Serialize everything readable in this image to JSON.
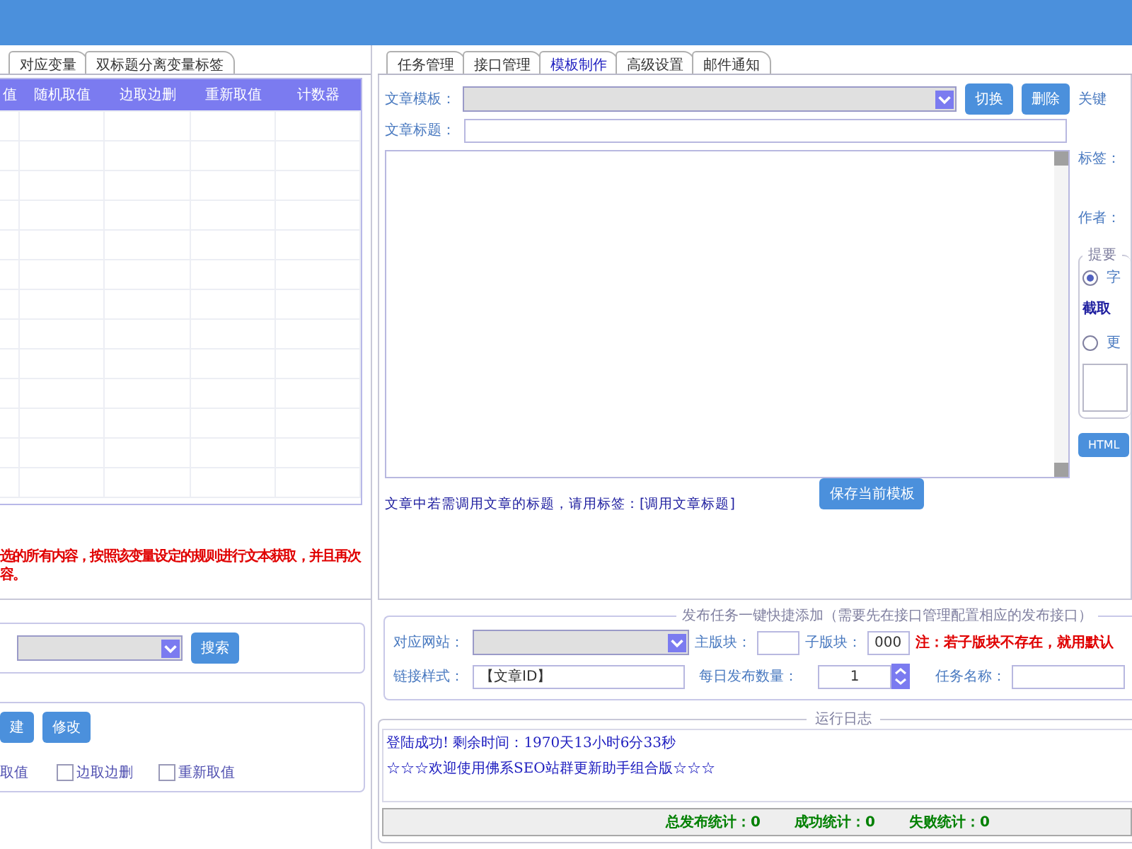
{
  "left_panel": {
    "tabs": [
      {
        "label": "对应变量",
        "selected": false
      },
      {
        "label": "双标题分离变量标签",
        "selected": false
      }
    ],
    "table": {
      "columns": [
        "值",
        "随机取值",
        "边取边删",
        "重新取值",
        "计数器"
      ]
    },
    "note_lines": [
      "选的所有内容，按照该变量设定的规则进行文本获取，并且再次",
      "容。"
    ],
    "search": {
      "button": "搜索"
    },
    "edit_group": {
      "buttons": [
        "建",
        "修改"
      ],
      "cut_label": "取值",
      "checkboxes": [
        {
          "label": "边取边删",
          "checked": false
        },
        {
          "label": "重新取值",
          "checked": false
        }
      ]
    }
  },
  "right_panel": {
    "tabs": [
      {
        "label": "任务管理",
        "selected": false
      },
      {
        "label": "接口管理",
        "selected": false
      },
      {
        "label": "模板制作",
        "selected": true
      },
      {
        "label": "高级设置",
        "selected": false
      },
      {
        "label": "邮件通知",
        "selected": false
      }
    ],
    "template_label": "文章模板：",
    "template_buttons": [
      "切换",
      "删除"
    ],
    "title_label": "文章标题：",
    "side": {
      "keyword_label": "关键",
      "tag_label": "标签：",
      "author_label": "作者：",
      "summary_legend": "提要",
      "radios": [
        {
          "label": "字",
          "selected": true
        },
        {
          "label": "更",
          "selected": false
        }
      ],
      "extract_label": "截取",
      "html_button": "HTML"
    },
    "hint": "文章中若需调用文章的标题，请用标签：[调用文章标题]",
    "save_button": "保存当前模板",
    "publish": {
      "legend": "发布任务一键快捷添加（需要先在接口管理配置相应的发布接口）",
      "site_label": "对应网站：",
      "main_board_label": "主版块：",
      "sub_board_label": "子版块：",
      "sub_board_value": "000",
      "note": "注：若子版块不存在，就用默认",
      "link_label": "链接样式：",
      "link_value": "【文章ID】",
      "daily_label": "每日发布数量：",
      "daily_value": "1",
      "task_label": "任务名称："
    },
    "log": {
      "legend": "运行日志",
      "lines": [
        "登陆成功! 剩余时间：1970天13小时6分33秒",
        "☆☆☆欢迎使用佛系SEO站群更新助手组合版☆☆☆"
      ]
    },
    "status_bar": [
      "总发布统计：0",
      "成功统计：0",
      "失败统计：0"
    ]
  }
}
